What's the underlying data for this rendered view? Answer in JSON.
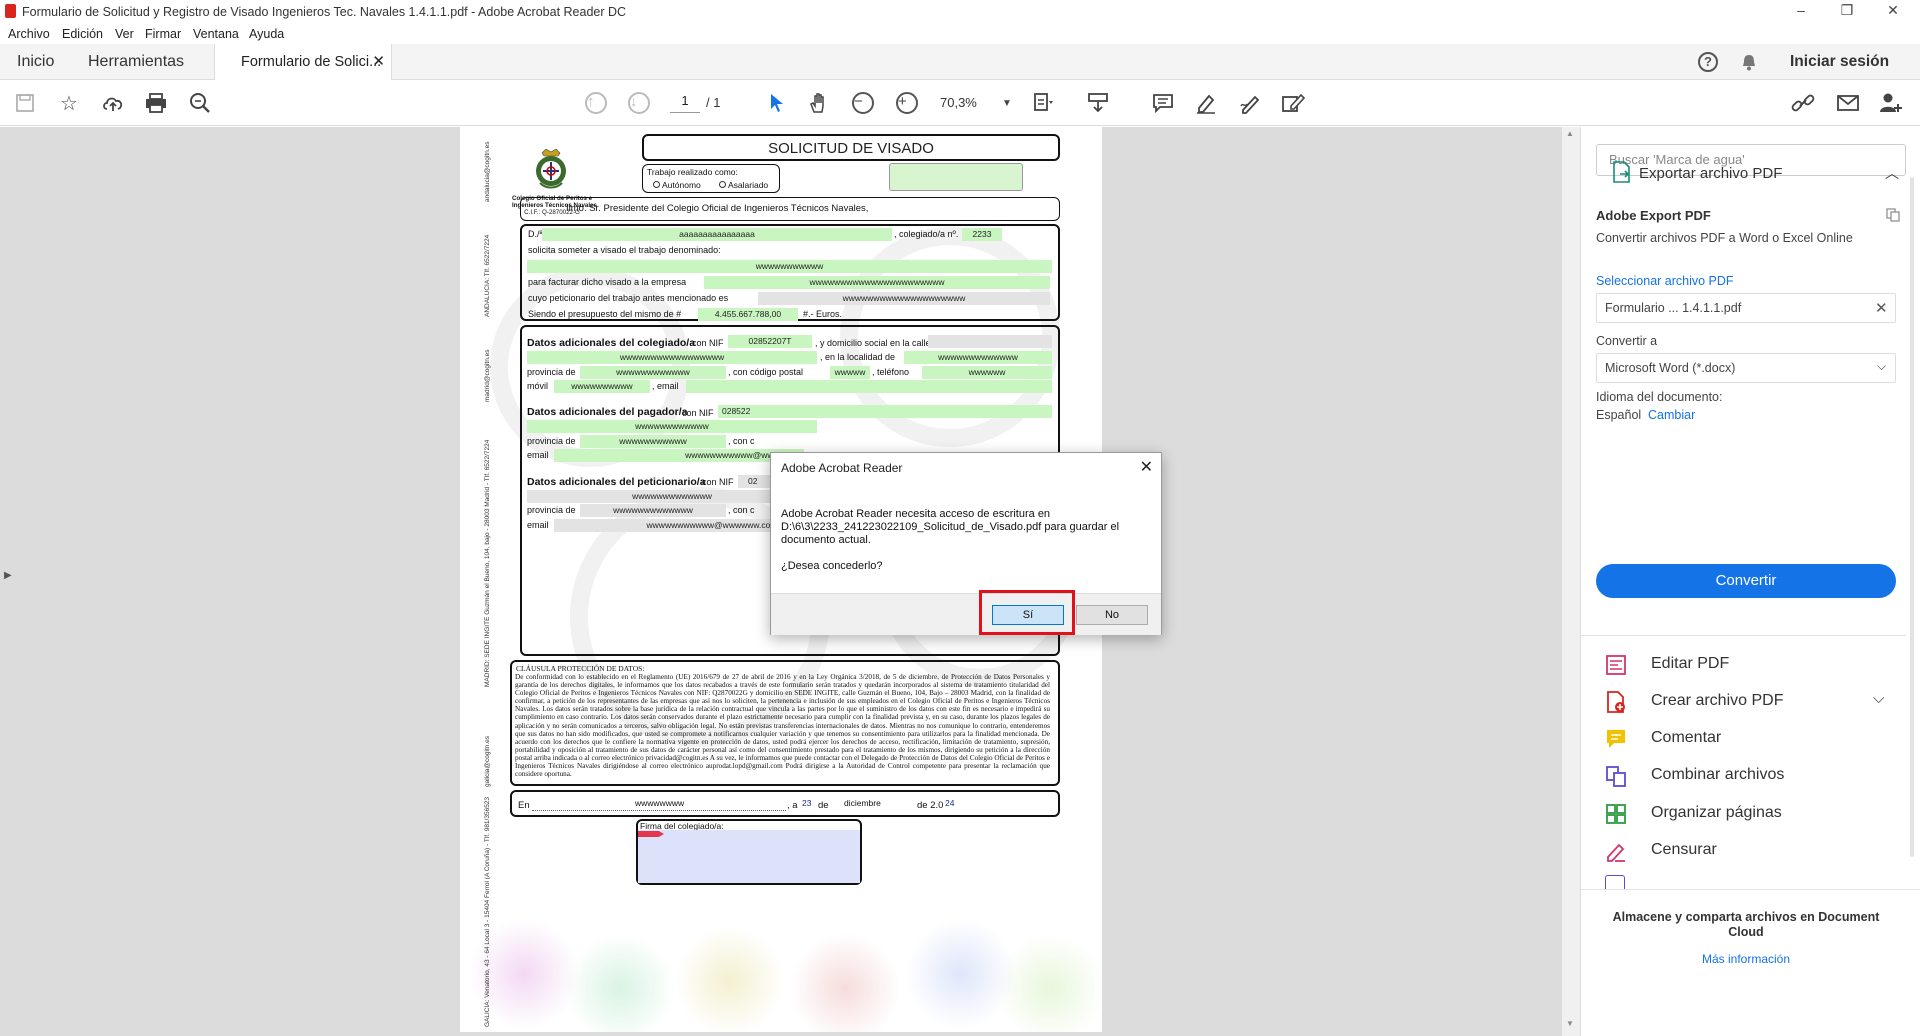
{
  "window": {
    "title": "Formulario de Solicitud y Registro de Visado Ingenieros Tec. Navales 1.4.1.1.pdf - Adobe Acrobat Reader DC",
    "minimize": "–",
    "maximize": "❐",
    "close": "✕"
  },
  "menu": [
    "Archivo",
    "Edición",
    "Ver",
    "Firmar",
    "Ventana",
    "Ayuda"
  ],
  "tabs": {
    "home": "Inicio",
    "tools": "Herramientas",
    "document": "Formulario de Solici...",
    "close": "✕",
    "signin": "Iniciar sesión"
  },
  "toolbar": {
    "page_current": "1",
    "page_total": "/ 1",
    "zoom": "70,3%"
  },
  "document": {
    "title": "SOLICITUD DE VISADO",
    "org_lines": [
      "Colegio Oficial de Peritos e",
      "Ingenieros Técnicos Navales",
      "C.I.F.: Q-2870022-G"
    ],
    "trabajo_label": "Trabajo realizado como:",
    "autonomo": "Autónomo",
    "asalariado": "Asalariado",
    "addressee": "Ilmo. Sr. Presidente del Colegio Oficial de Ingenieros Técnicos Navales,",
    "d_label": "D./ª",
    "d_value": "aaaaaaaaaaaaaaaa",
    "colegiado_label": ", colegiado/a nº.",
    "colegiado_value": "2233",
    "solicita": "solicita someter a visado el trabajo denominado:",
    "trabajo_value": "wwwwwwwwwww",
    "facturar_label": "para facturar dicho visado a la empresa",
    "empresa_value": "wwwwwwwwwwwwwwwwwwwwww",
    "peticionario_label": "cuyo peticionario del trabajo antes mencionado es",
    "peticionario_value": "wwwwwwwwwwwwwwwwwwww",
    "presupuesto_label": "Siendo el presupuesto del mismo de #",
    "presupuesto_value": "4.455.667.788,00",
    "euros": "#.- Euros.",
    "colegiado_section": "Datos adicionales del colegiado/a",
    "con_nif": "con NIF",
    "nif_value": "02852207T",
    "domicilio": ", y domicilio social en la calle",
    "calle_value": "wwwwwwwwwwwwwwwww",
    "localidad_label": ", en la localidad de",
    "localidad_value": "wwwwwwwwwwwww",
    "provincia_label": "provincia de",
    "provincia_value": "wwwwwwwwwwww",
    "cp_label": ", con código postal",
    "cp_value": "wwwww",
    "telefono_label": ", teléfono",
    "telefono_value": "wwwwww",
    "movil_label": "móvil",
    "movil_value": "wwwwwwwwww",
    "email_short_label": ", email",
    "pagador_section": "Datos adicionales del pagador/a",
    "pagador_nif": "028522",
    "pagador_calle": "wwwwwwwwwwww",
    "pagador_provincia": "wwwwwwwwwww",
    "con_c": ", con c",
    "email_label": "email",
    "pagador_email": "wwwwwwwwwww@wwwwww.",
    "peticionario_section": "Datos adicionales del peticionario/a",
    "pet_nif": "02",
    "pet_calle": "wwwwwwwwwwwww",
    "pet_provincia": "wwwwwwwwwwwww",
    "pet_email": "wwwwwwwwwww@wwwwww.com",
    "clausula_title": "CLÁUSULA PROTECCIÓN DE DATOS:",
    "clausula_text": "De conformidad con lo establecido en el Reglamento (UE) 2016/679 de 27 de abril de 2016 y en la Ley Orgánica 3/2018, de 5 de diciembre, de Protección de Datos Personales y garantía de los derechos digitales, le informamos que los datos recabados a través de este formulario serán tratados y quedarán incorporados al sistema de tratamiento titularidad del Colegio Oficial de Peritos e Ingenieros Técnicos Navales con NIF: Q2870022G y domicilio en SEDE INGITE, calle Guzmán el Bueno, 104, Bajo – 28003 Madrid, con la finalidad de confirmar, a petición de los representantes de las empresas que así nos lo soliciten, la pertenencia e inclusión de sus empleados en el Colegio Oficial de Peritos e Ingenieros Técnicos Navales. Los datos serán tratados sobre la base jurídica de la relación contractual que vincula a las partes por lo que el suministro de los datos con este fin es necesario e impedirá su cumplimiento en caso contrario. Los datos serán conservados durante el plazo estrictamente necesario para cumplir con la finalidad prevista y, en su caso, durante los plazos legales de aplicación y no serán comunicados a terceros, salvo obligación legal. No están previstas transferencias internacionales de datos. Mientras no nos comunique lo contrario, entenderemos que sus datos no han sido modificados, que usted se compromete a notificarnos cualquier variación y que tenemos su consentimiento para utilizarlos para la finalidad mencionada. De acuerdo con los derechos que le confiere la normativa vigente en protección de datos, usted podrá ejercer los derechos de acceso, rectificación, limitación de tratamiento, supresión, portabilidad y oposición al tratamiento de sus datos de carácter personal así como del consentimiento prestado para el tratamiento de los mismos, dirigiendo su petición a la dirección postal arriba indicada o al correo electrónico privacidad@cogitn.es A su vez, le informamos que puede contactar con el Delegado de Protección de Datos del Colegio Oficial de Peritos e Ingenieros Técnicos Navales dirigiéndose al correo electrónico auprodat.lopd@gmail.com Podrá dirigirse a la Autoridad de Control competente para presentar la reclamación que considere oportuna.",
    "en_label": "En",
    "en_value": "wwwwwwww",
    "a_label": ", a",
    "dia_value": "23",
    "de_label": "de",
    "mes_value": "diciembre",
    "de2_label": "de 2.0",
    "anio_value": "24",
    "firma_label": "Firma del colegiado/a:",
    "side_texts": [
      "andalucia@cogitn.es",
      "ANDALUCIA: Tlf. 6522/7224",
      "madrid@cogitn.es",
      "MADRID: SEDE INGITE Guzmán el Bueno, 104, bajo - 28003 Madrid - Tlf. 6522/7224",
      "galicia@cogitn.es",
      "GALICIA: Venatorio, 43 - 64 Local 3 - 15404 Ferrol (A Coruña) - Tlf. 981/356523"
    ]
  },
  "dialog": {
    "title": "Adobe Acrobat Reader",
    "close": "✕",
    "message": "Adobe Acrobat Reader necesita acceso de escritura en D:\\6\\3\\2233_241223022109_Solicitud_de_Visado.pdf para guardar el documento actual.",
    "question": "¿Desea concederlo?",
    "yes": "Sí",
    "no": "No"
  },
  "right_panel": {
    "search_placeholder": "Buscar 'Marca de agua'",
    "export_header": "Exportar archivo PDF",
    "export_title": "Adobe Export PDF",
    "export_desc": "Convertir archivos PDF a Word o Excel Online",
    "select_file": "Seleccionar archivo PDF",
    "file_name": "Formulario ... 1.4.1.1.pdf",
    "convert_to": "Convertir a",
    "format": "Microsoft Word (*.docx)",
    "doc_lang": "Idioma del documento:",
    "lang_value": "Español",
    "change": "Cambiar",
    "convert_btn": "Convertir",
    "tools": [
      "Editar PDF",
      "Crear archivo PDF",
      "Comentar",
      "Combinar archivos",
      "Organizar páginas",
      "Censurar"
    ],
    "cloud_text": "Almacene y comparta archivos en Document Cloud",
    "more_info": "Más información"
  },
  "colors": {
    "accent": "#1473e6",
    "field_green": "#c9f5c0",
    "highlight": "#e1111b"
  }
}
